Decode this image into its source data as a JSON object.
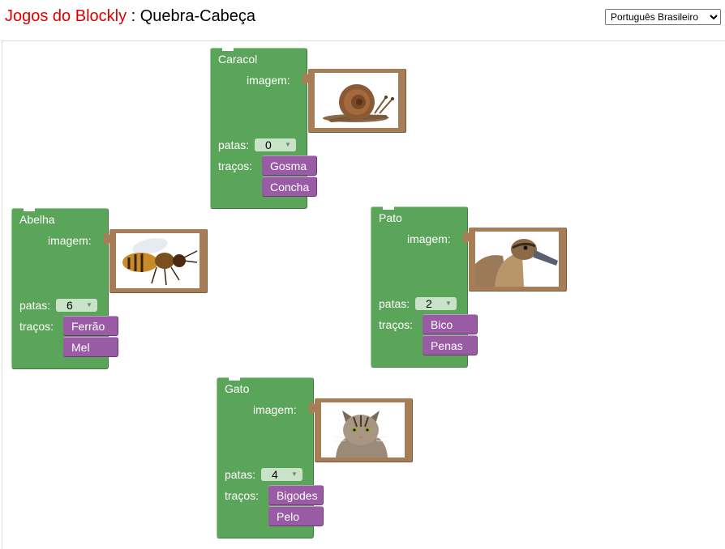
{
  "header": {
    "app_name": "Jogos do Blockly",
    "separator": " : ",
    "page_name": "Quebra-Cabeça",
    "language_selected": "Português Brasileiro"
  },
  "labels": {
    "image": "imagem:",
    "legs": "patas:",
    "traits": "traços:"
  },
  "animals": [
    {
      "name": "Caracol",
      "legs": "0",
      "traits": [
        "Gosma",
        "Concha"
      ],
      "picture": "snail-picture"
    },
    {
      "name": "Abelha",
      "legs": "6",
      "traits": [
        "Ferrão",
        "Mel"
      ],
      "picture": "bee-picture"
    },
    {
      "name": "Pato",
      "legs": "2",
      "traits": [
        "Bico",
        "Penas"
      ],
      "picture": "duck-picture"
    },
    {
      "name": "Gato",
      "legs": "4",
      "traits": [
        "Bigodes",
        "Pelo"
      ],
      "picture": "cat-picture"
    }
  ],
  "colors": {
    "title_accent": "#dd0000",
    "animal_block": "#5ba55b",
    "trait_block": "#9a5ba5",
    "picture_block": "#a67d57"
  }
}
